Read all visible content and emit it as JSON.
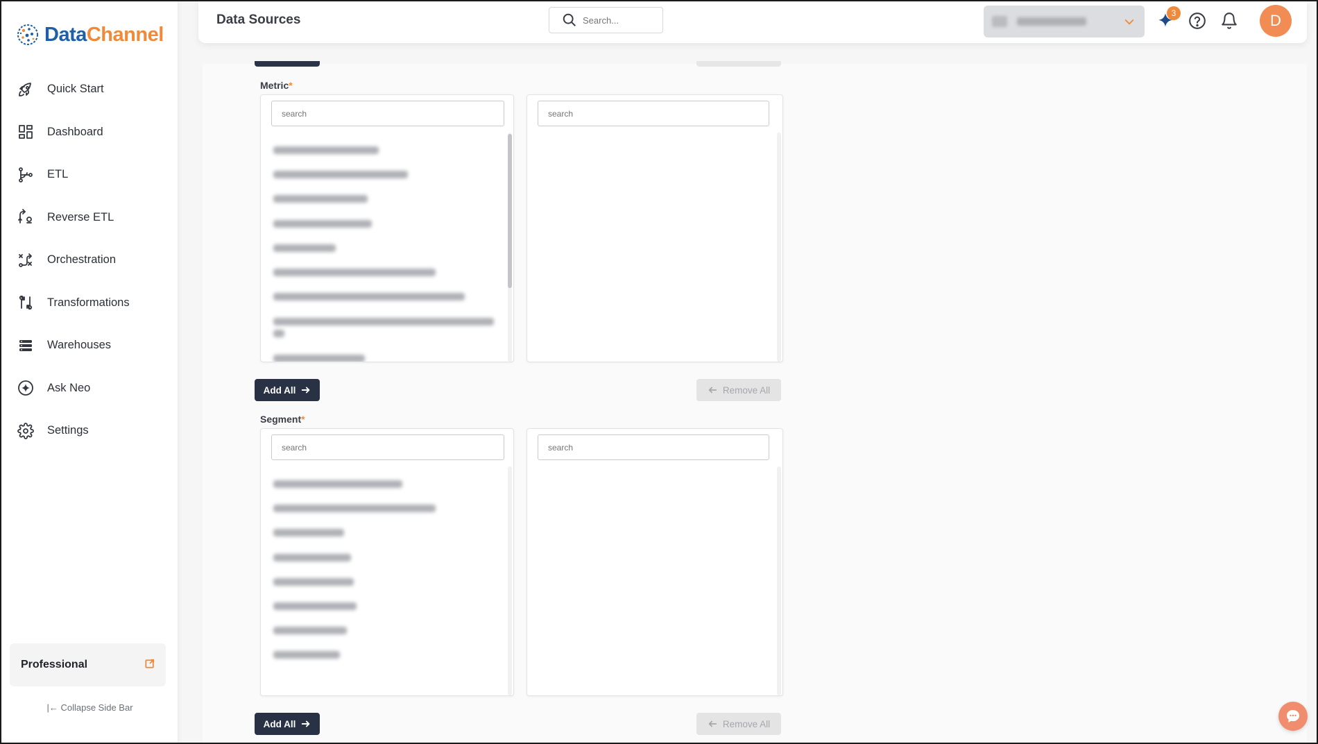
{
  "app": {
    "logo_part1": "Data",
    "logo_part2": "Channel"
  },
  "header": {
    "title": "Data Sources",
    "search_placeholder": "Search...",
    "notification_badge": "3",
    "avatar_initial": "D"
  },
  "sidebar": {
    "items": [
      {
        "label": "Quick Start",
        "icon": "rocket-icon"
      },
      {
        "label": "Dashboard",
        "icon": "dashboard-icon"
      },
      {
        "label": "ETL",
        "icon": "etl-icon"
      },
      {
        "label": "Reverse ETL",
        "icon": "reverse-etl-icon"
      },
      {
        "label": "Orchestration",
        "icon": "orchestration-icon"
      },
      {
        "label": "Transformations",
        "icon": "transformations-icon"
      },
      {
        "label": "Warehouses",
        "icon": "warehouses-icon"
      },
      {
        "label": "Ask Neo",
        "icon": "sparkle-icon"
      },
      {
        "label": "Settings",
        "icon": "gear-icon"
      }
    ],
    "plan_label": "Professional",
    "collapse_label": "Collapse Side Bar"
  },
  "metric": {
    "label": "Metric",
    "required_mark": "*",
    "available_search_placeholder": "search",
    "selected_search_placeholder": "search",
    "add_all_label": "Add All",
    "remove_all_label": "Remove All"
  },
  "segment": {
    "label": "Segment",
    "required_mark": "*",
    "available_search_placeholder": "search",
    "selected_search_placeholder": "search",
    "add_all_label": "Add All",
    "remove_all_label": "Remove All"
  },
  "colors": {
    "accent": "#ef8a3b",
    "brand_blue": "#1f5fa8",
    "primary_button": "#283244",
    "avatar": "#f08c54"
  }
}
